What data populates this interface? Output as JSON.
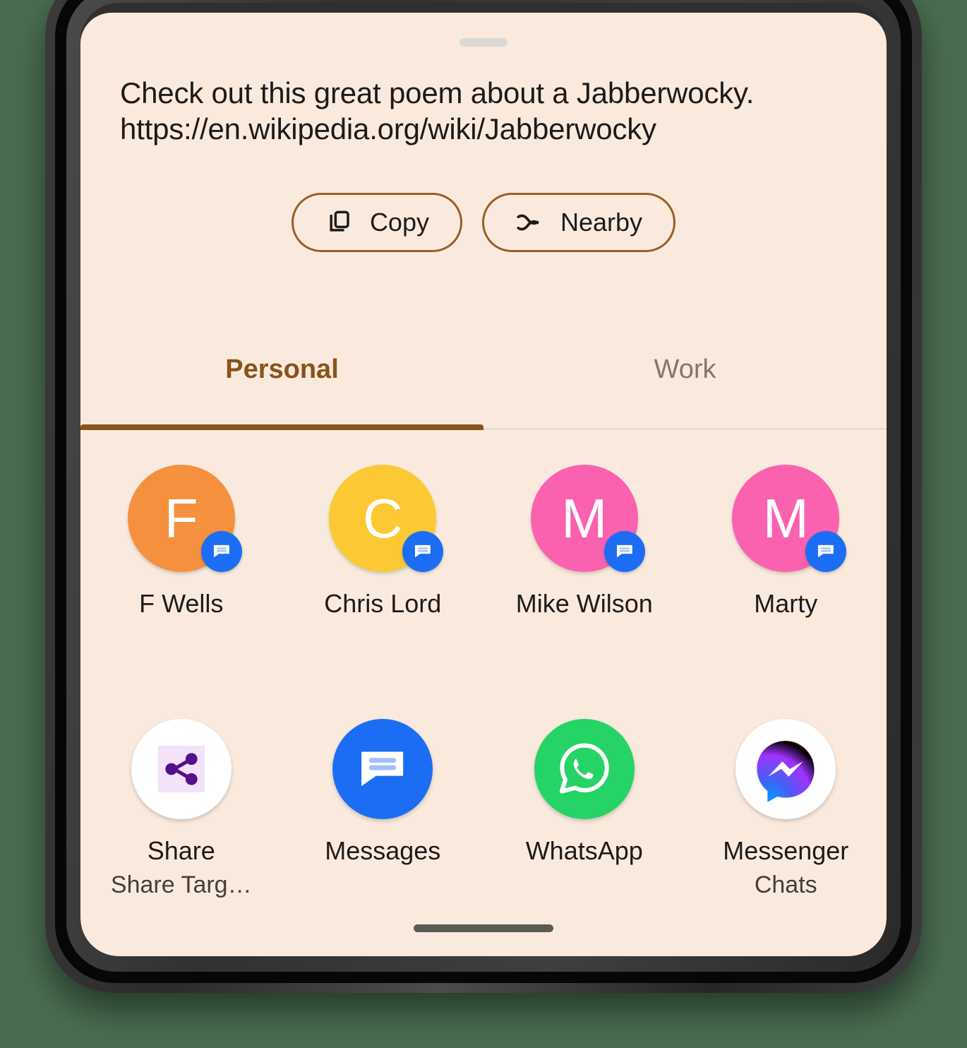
{
  "colors": {
    "background": "#4a6d50",
    "sheet": "#faeade",
    "accent": "#8a5318",
    "chip_border": "#9a5f22",
    "text_primary": "#1d1b19",
    "text_muted": "#7d7771",
    "badge_blue": "#1b6ef3"
  },
  "sheet": {
    "drag_handle": "drag-handle",
    "preview": {
      "line1": "Check out this great poem about a Jabberwocky.",
      "line2": "https://en.wikipedia.org/wiki/Jabberwocky"
    },
    "actions": [
      {
        "label": "Copy",
        "icon": "copy-icon"
      },
      {
        "label": "Nearby",
        "icon": "nearby-share-icon"
      }
    ],
    "tabs": [
      {
        "label": "Personal",
        "active": true
      },
      {
        "label": "Work",
        "active": false
      }
    ],
    "contacts": [
      {
        "name": "F Wells",
        "initial": "F",
        "color": "#f5913e",
        "badge": "messages-icon"
      },
      {
        "name": "Chris Lord",
        "initial": "C",
        "color": "#fcc934",
        "badge": "messages-icon"
      },
      {
        "name": "Mike Wilson",
        "initial": "M",
        "color": "#fa62b0",
        "badge": "messages-icon"
      },
      {
        "name": "Marty",
        "initial": "M",
        "color": "#fa62b0",
        "badge": "messages-icon"
      }
    ],
    "apps": [
      {
        "name": "Share",
        "subtitle": "Share Targ…",
        "icon": "share-icon"
      },
      {
        "name": "Messages",
        "subtitle": "",
        "icon": "messages-icon"
      },
      {
        "name": "WhatsApp",
        "subtitle": "",
        "icon": "whatsapp-icon"
      },
      {
        "name": "Messenger",
        "subtitle": "Chats",
        "icon": "messenger-icon"
      }
    ],
    "gesture_bar": "home-gesture-bar"
  }
}
